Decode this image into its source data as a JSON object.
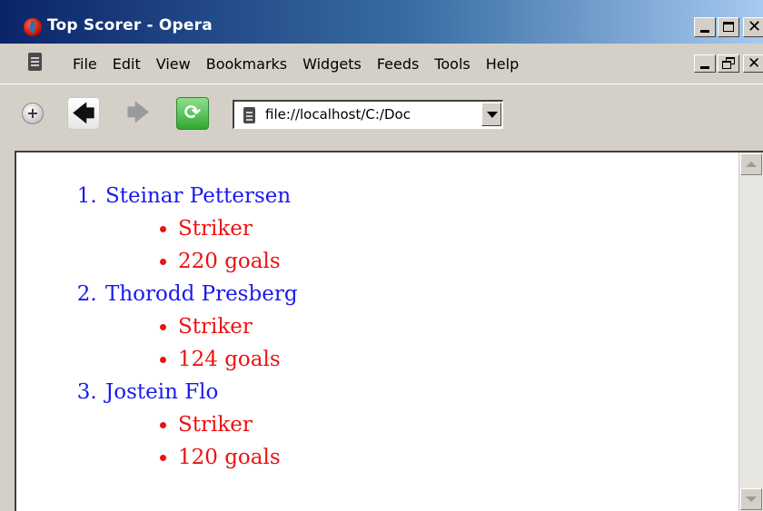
{
  "window": {
    "title": "Top Scorer - Opera"
  },
  "menu": {
    "items": [
      "File",
      "Edit",
      "View",
      "Bookmarks",
      "Widgets",
      "Feeds",
      "Tools",
      "Help"
    ]
  },
  "toolbar": {
    "address_value": "file://localhost/C:/Doc"
  },
  "content": {
    "scorers": [
      {
        "name": "Steinar Pettersen",
        "position": "Striker",
        "goals": "220 goals"
      },
      {
        "name": "Thorodd Presberg",
        "position": "Striker",
        "goals": "124 goals"
      },
      {
        "name": "Jostein Flo",
        "position": "Striker",
        "goals": "120 goals"
      }
    ]
  },
  "colors": {
    "list_text": "#1a1aee",
    "detail_text": "#ee1111",
    "chrome": "#d4d0c8"
  },
  "icons": {
    "app": "opera-logo-icon",
    "new_tab": "plus-icon",
    "back": "arrow-left-icon",
    "forward": "arrow-right-icon",
    "reload": "reload-icon",
    "page": "document-icon"
  }
}
